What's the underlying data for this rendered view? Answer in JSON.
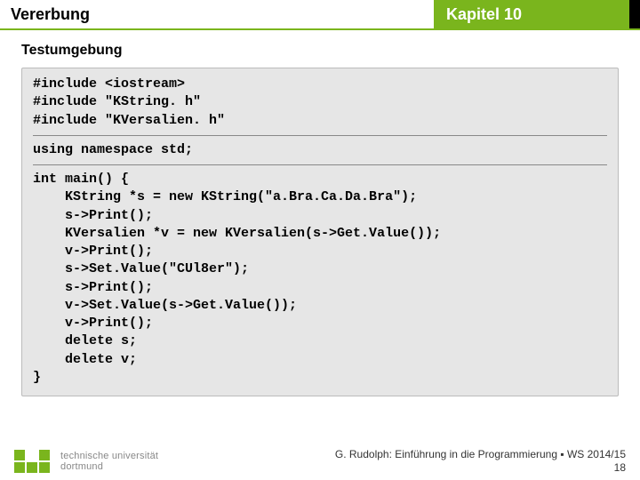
{
  "header": {
    "left": "Vererbung",
    "right": "Kapitel 10"
  },
  "subtitle": "Testumgebung",
  "code": {
    "includes": [
      "#include <iostream>",
      "#include \"KString. h\"",
      "#include \"KVersalien. h\""
    ],
    "using": "using namespace std;",
    "main": [
      "int main() {",
      "    KString *s = new KString(\"a.Bra.Ca.Da.Bra\");",
      "    s->Print();",
      "    KVersalien *v = new KVersalien(s->Get.Value());",
      "    v->Print();",
      "    s->Set.Value(\"CUl8er\");",
      "    s->Print();",
      "    v->Set.Value(s->Get.Value());",
      "    v->Print();",
      "    delete s;",
      "    delete v;",
      "}"
    ]
  },
  "logo": {
    "line1": "technische universität",
    "line2": "dortmund"
  },
  "footer": {
    "credit": "G. Rudolph: Einführung in die Programmierung ▪ WS 2014/15",
    "page": "18"
  }
}
